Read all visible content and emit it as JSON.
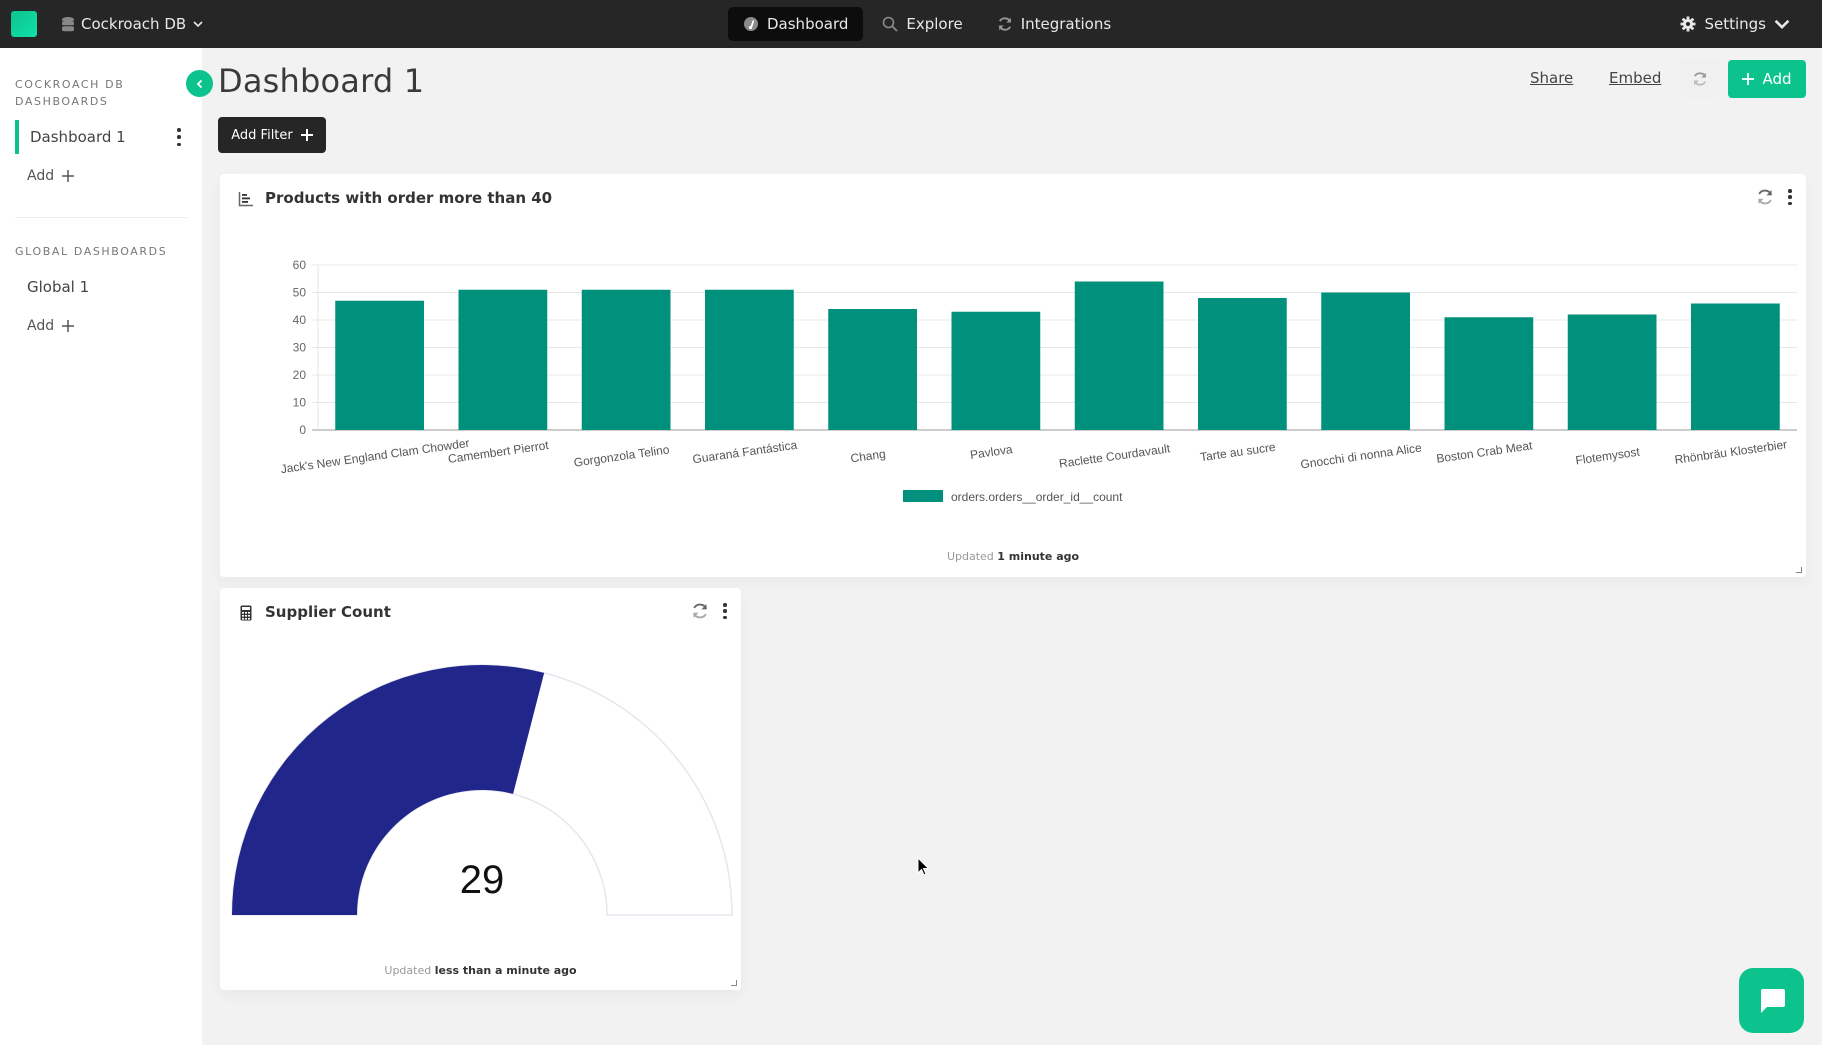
{
  "topbar": {
    "database": "Cockroach DB",
    "nav": [
      {
        "label": "Dashboard",
        "icon": "dashboard-gauge-icon",
        "active": true
      },
      {
        "label": "Explore",
        "icon": "search-icon",
        "active": false
      },
      {
        "label": "Integrations",
        "icon": "sync-icon",
        "active": false
      }
    ],
    "settings_label": "Settings"
  },
  "sidebar": {
    "section1_title": "COCKROACH DB DASHBOARDS",
    "section1_items": [
      {
        "label": "Dashboard 1",
        "active": true
      }
    ],
    "section1_add": "Add",
    "section2_title": "GLOBAL DASHBOARDS",
    "section2_items": [
      {
        "label": "Global 1",
        "active": false
      }
    ],
    "section2_add": "Add"
  },
  "header": {
    "title": "Dashboard 1",
    "share_label": "Share",
    "embed_label": "Embed",
    "add_label": "Add",
    "add_filter_label": "Add Filter"
  },
  "colors": {
    "accent": "#0cc38e",
    "bar": "#00917c",
    "gauge_fill": "#21268a",
    "topbar": "#262626"
  },
  "cards": {
    "bar_card": {
      "title": "Products with order more than 40",
      "updated_prefix": "Updated",
      "updated_value": "1 minute ago"
    },
    "gauge_card": {
      "title": "Supplier Count",
      "value_label": "29",
      "updated_prefix": "Updated",
      "updated_value": "less than a minute ago"
    }
  },
  "chart_data": [
    {
      "type": "bar",
      "title": "Products with order more than 40",
      "xlabel": "",
      "ylabel": "",
      "categories": [
        "Jack's New England Clam Chowder",
        "Camembert Pierrot",
        "Gorgonzola Telino",
        "Guaraná Fantástica",
        "Chang",
        "Pavlova",
        "Raclette Courdavault",
        "Tarte au sucre",
        "Gnocchi di nonna Alice",
        "Boston Crab Meat",
        "Flotemysost",
        "Rhönbräu Klosterbier"
      ],
      "series": [
        {
          "name": "orders.orders__order_id__count",
          "values": [
            47,
            51,
            51,
            51,
            44,
            43,
            54,
            48,
            50,
            41,
            42,
            46
          ]
        }
      ],
      "ylim": [
        0,
        60
      ],
      "yticks": [
        0,
        10,
        20,
        30,
        40,
        50,
        60
      ],
      "grid": true,
      "legend": "bottom-center"
    },
    {
      "type": "gauge",
      "title": "Supplier Count",
      "value": 29,
      "min": 0,
      "max": 50
    }
  ]
}
